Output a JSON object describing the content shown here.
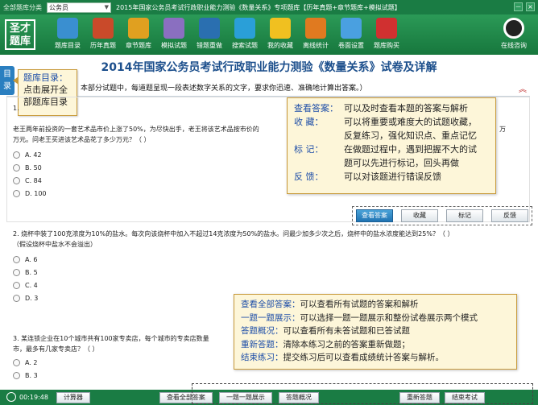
{
  "topbar": {
    "category_label": "全部题库分类",
    "selected": "公务员",
    "title": "2015年国家公务员考试行政职业能力测验《数量关系》专项题库【历年真题+章节题库+模拟试题】",
    "win_min": "－",
    "win_close": "×"
  },
  "logo": "圣才题库",
  "toolbar": {
    "items": [
      {
        "label": "题库目录",
        "color": "#3a8fd0"
      },
      {
        "label": "历年真题",
        "color": "#c94a2a"
      },
      {
        "label": "章节题库",
        "color": "#e0a020"
      },
      {
        "label": "模拟试题",
        "color": "#8a6fc0"
      },
      {
        "label": "错题重做",
        "color": "#2a6fb0"
      },
      {
        "label": "搜索试题",
        "color": "#2a9fd8"
      },
      {
        "label": "我的收藏",
        "color": "#f0c020"
      },
      {
        "label": "离线统计",
        "color": "#e07a20"
      },
      {
        "label": "卷面设置",
        "color": "#4aa0e0"
      },
      {
        "label": "题库购买",
        "color": "#d03030"
      }
    ],
    "qq_label": "在线咨询"
  },
  "page_title": "2014年国家公务员考试行政职业能力测验《数量关系》试卷及详解",
  "dir_tab": "目录",
  "note_dir": [
    "题库目录：",
    "点击展开全",
    "部题库目录"
  ],
  "instruction": "本部分试题中，每道题呈现一段表述数字关系的文字，要求你迅速、准确地计算出答案。）",
  "collapse": "︽",
  "questions": [
    {
      "num": "1.",
      "text": "老王两年前投资的一套艺术品市价上涨了50%，为尽快出手，老王将该艺术品按市价的",
      "text2": "万元。问老王买进该艺术品花了多少万元？（      ）",
      "tail": "万",
      "options": [
        "A. 42",
        "B. 50",
        "C. 84",
        "D. 100"
      ]
    },
    {
      "num": "2.",
      "text": "2. 烧杯中装了100克浓度为10%的盐水。每次向该烧杯中加入不超过14克浓度为50%的盐水。问最少加多少次之后，烧杯中的盐水浓度能达到25%？（      ）",
      "text2": "（假设烧杯中盐水不会溢出）",
      "options": [
        "A. 6",
        "B. 5",
        "C. 4",
        "D. 3"
      ]
    },
    {
      "num": "3.",
      "text": "3. 某连锁企业在10个城市共有100家专卖店，每个城市的专卖店数量",
      "text2": "市，最多有几家专卖店？（      ）",
      "options": [
        "A. 2",
        "B. 3"
      ]
    }
  ],
  "answer_buttons": [
    "查看答案",
    "收藏",
    "标记",
    "反馈"
  ],
  "note1": [
    {
      "k": "查看答案：",
      "v": "可以及时查看本题的答案与解析"
    },
    {
      "k": "收      藏：",
      "v": "可以将重要或难度大的试题收藏，"
    },
    {
      "k": "",
      "v": "反复练习，强化知识点、重点记忆"
    },
    {
      "k": "标      记：",
      "v": "在做题过程中，遇到把握不大的试"
    },
    {
      "k": "",
      "v": "题可以先进行标记，回头再做"
    },
    {
      "k": "反      馈：",
      "v": "可以对该题进行错误反馈"
    }
  ],
  "note2": [
    {
      "k": "查看全部答案：",
      "v": "可以查看所有试题的答案和解析"
    },
    {
      "k": "一题一题展示：",
      "v": "可以选择一题一题展示和整份试卷展示两个模式"
    },
    {
      "k": "答题概况：",
      "v": "可以查看所有未答试题和已答试题"
    },
    {
      "k": "重新答题：",
      "v": "清除本练习之前的答案重新做题；"
    },
    {
      "k": "结束练习：",
      "v": "提交练习后可以查看成绩统计答案与解析。"
    }
  ],
  "bottom": {
    "clock": "00:19:48",
    "calculator": "计算器",
    "view_all": "查看全部答案",
    "one_by_one": "一题一题展示",
    "overview": "答题概况",
    "restart": "重新答题",
    "finish": "结束考试"
  }
}
